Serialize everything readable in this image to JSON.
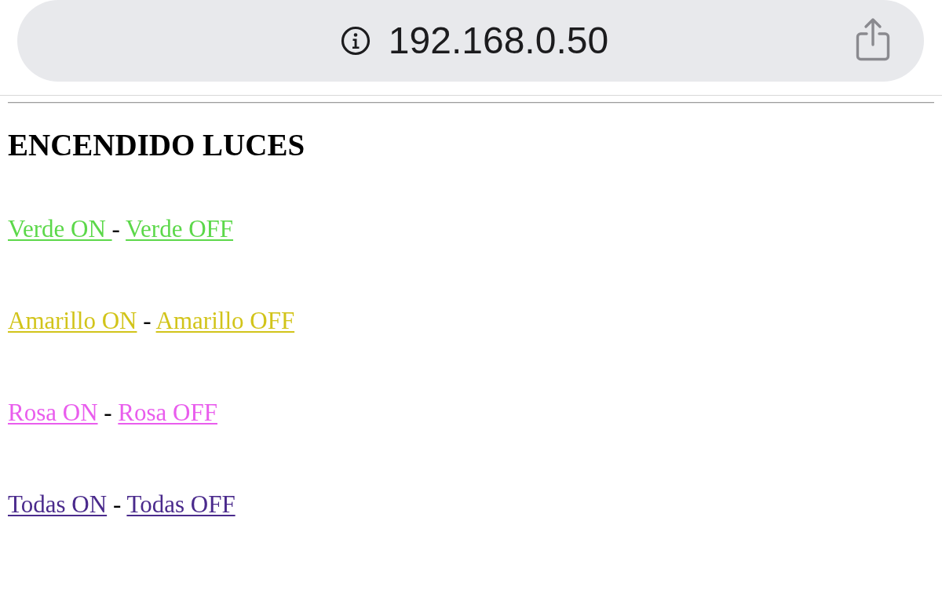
{
  "address_bar": {
    "url": "192.168.0.50"
  },
  "heading": "ENCENDIDO LUCES",
  "rows": [
    {
      "links": [
        {
          "label": "Verde ON ",
          "color": "#5cd84a"
        },
        {
          "label": "Verde OFF",
          "color": "#5cd84a"
        }
      ],
      "separator": "-"
    },
    {
      "links": [
        {
          "label": "Amarillo ON",
          "color": "#d2c41a"
        },
        {
          "label": "Amarillo OFF",
          "color": "#d2c41a"
        }
      ],
      "separator": "-"
    },
    {
      "links": [
        {
          "label": "Rosa ON",
          "color": "#e95ded"
        },
        {
          "label": "Rosa OFF",
          "color": "#e95ded"
        }
      ],
      "separator": "-"
    },
    {
      "links": [
        {
          "label": "Todas ON",
          "color": "#4a2a8c"
        },
        {
          "label": "Todas OFF",
          "color": "#4a2a8c"
        }
      ],
      "separator": "-"
    }
  ]
}
